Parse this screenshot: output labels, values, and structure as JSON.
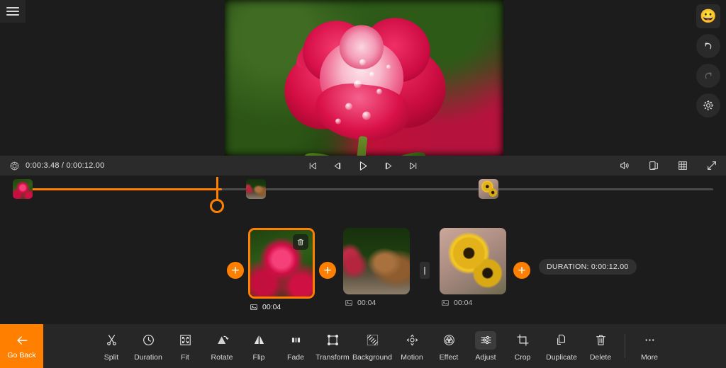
{
  "app": {
    "menu_icon": "hamburger-icon",
    "background": "#1c1c1c",
    "accent": "#ff8000"
  },
  "right_rail": {
    "items": [
      {
        "name": "emoji-button",
        "icon": "smiley-face-icon",
        "glyph": "😀",
        "state": "active"
      },
      {
        "name": "undo-button",
        "icon": "undo-arrow-icon",
        "state": "enabled"
      },
      {
        "name": "redo-button",
        "icon": "redo-arrow-icon",
        "state": "disabled"
      },
      {
        "name": "settings-button",
        "icon": "gear-icon",
        "state": "enabled"
      }
    ]
  },
  "preview": {
    "name": "video-preview",
    "content": "red-pink-rose-with-water-droplets-on-blurred-green-background"
  },
  "player": {
    "quality_icon": "circle-settings-icon",
    "timecode": "0:00:3.48 / 0:00:12.00",
    "current_time": "0:00:3.48",
    "total_time": "0:00:12.00",
    "controls": [
      {
        "name": "skip-to-start-button",
        "icon": "skip-start-icon"
      },
      {
        "name": "step-backward-button",
        "icon": "step-back-icon"
      },
      {
        "name": "play-button",
        "icon": "play-icon"
      },
      {
        "name": "step-forward-button",
        "icon": "step-forward-icon"
      },
      {
        "name": "skip-to-end-button",
        "icon": "skip-end-icon"
      }
    ],
    "right_controls": [
      {
        "name": "volume-button",
        "icon": "speaker-volume-icon"
      },
      {
        "name": "aspect-ratio-button",
        "icon": "copy-frames-icon"
      },
      {
        "name": "grid-button",
        "icon": "grid-icon"
      },
      {
        "name": "fullscreen-button",
        "icon": "expand-diagonal-icon"
      }
    ]
  },
  "timeline": {
    "name": "timeline-scrubber",
    "progress_percent": 29,
    "playhead_x_percent": 29,
    "thumbnails": [
      {
        "name": "timeline-thumb-rose",
        "art": "art-rose",
        "left_percent": 0
      },
      {
        "name": "timeline-thumb-squirrel",
        "art": "art-squirrel",
        "left_percent": 33.4
      },
      {
        "name": "timeline-thumb-sunflower",
        "art": "art-sunflower",
        "left_percent": 66.7
      }
    ]
  },
  "clips": {
    "add_label": "+",
    "items": [
      {
        "name": "clip-rose",
        "art": "art-rose",
        "duration": "00:04",
        "selected": true,
        "media_icon": "photo-icon",
        "delete_icon": "trash-icon"
      },
      {
        "name": "clip-squirrel",
        "art": "art-squirrel",
        "duration": "00:04",
        "selected": false,
        "media_icon": "photo-icon"
      },
      {
        "name": "clip-sunflower",
        "art": "art-sunflower",
        "duration": "00:04",
        "selected": false,
        "media_icon": "photo-icon"
      }
    ],
    "transition_handle_icon": "vertical-bar-icon",
    "duration_badge": "DURATION: 0:00:12.00"
  },
  "toolbar": {
    "go_back_label": "Go Back",
    "go_back_icon": "arrow-left-icon",
    "tools": [
      {
        "name": "split",
        "label": "Split",
        "icon": "scissors-icon",
        "active": false
      },
      {
        "name": "duration",
        "label": "Duration",
        "icon": "clock-icon",
        "active": false
      },
      {
        "name": "fit",
        "label": "Fit",
        "icon": "fit-corners-icon",
        "active": false
      },
      {
        "name": "rotate",
        "label": "Rotate",
        "icon": "rotate-icon",
        "active": false
      },
      {
        "name": "flip",
        "label": "Flip",
        "icon": "flip-icon",
        "active": false
      },
      {
        "name": "fade",
        "label": "Fade",
        "icon": "fade-bars-icon",
        "active": false
      },
      {
        "name": "transform",
        "label": "Transform",
        "icon": "transform-handles-icon",
        "active": false
      },
      {
        "name": "background",
        "label": "Background",
        "icon": "hatch-pattern-icon",
        "active": false
      },
      {
        "name": "motion",
        "label": "Motion",
        "icon": "motion-arrows-icon",
        "active": false
      },
      {
        "name": "effect",
        "label": "Effect",
        "icon": "venn-circles-icon",
        "active": false
      },
      {
        "name": "adjust",
        "label": "Adjust",
        "icon": "sliders-icon",
        "active": true
      },
      {
        "name": "crop",
        "label": "Crop",
        "icon": "crop-icon",
        "active": false
      },
      {
        "name": "duplicate",
        "label": "Duplicate",
        "icon": "duplicate-pages-icon",
        "active": false
      },
      {
        "name": "delete",
        "label": "Delete",
        "icon": "trash-icon",
        "active": false
      },
      {
        "name": "more",
        "label": "More",
        "icon": "ellipsis-icon",
        "active": false
      }
    ]
  }
}
